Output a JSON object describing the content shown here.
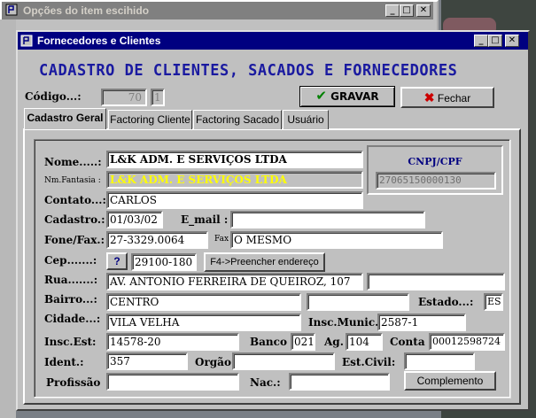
{
  "background_window": {
    "title": "Opções do item escihido"
  },
  "window": {
    "title": "Fornecedores e Clientes",
    "minimize": "_",
    "maximize": "□",
    "close": "✕"
  },
  "heading": "CADASTRO DE  CLIENTES, SACADOS E FORNECEDORES",
  "codigo": {
    "label": "Código...:",
    "value": "70",
    "suffix": "1"
  },
  "buttons": {
    "gravar": "GRAVAR",
    "fechar": "Fechar",
    "help": "?",
    "preencher": "F4->Preencher endereço",
    "complemento": "Complemento"
  },
  "tabs": [
    {
      "label": "Cadastro Geral"
    },
    {
      "label": "Factoring Cliente"
    },
    {
      "label": "Factoring  Sacado"
    },
    {
      "label": "Usuário"
    }
  ],
  "cnpj": {
    "label": "CNPJ/CPF",
    "value": "27065150000130"
  },
  "form": {
    "nome": {
      "label": "Nome.....:",
      "value": "L&K ADM. E SERVIÇOS LTDA"
    },
    "fantasia": {
      "label": "Nm.Fantasia :",
      "value": "L&K ADM. E SERVIÇOS LTDA"
    },
    "contato": {
      "label": "Contato...:",
      "value": "CARLOS"
    },
    "cadastro": {
      "label": "Cadastro.:",
      "value": "01/03/02"
    },
    "email": {
      "label": "E_mail :",
      "value": ""
    },
    "fone": {
      "label": "Fone/Fax.:",
      "value": "27-3329.0064"
    },
    "fax": {
      "label": "Fax",
      "value": "O MESMO"
    },
    "cep": {
      "label": "Cep.......:",
      "value": "29100-180"
    },
    "rua": {
      "label": "Rua.......:",
      "value": "AV. ANTONIO FERREIRA DE QUEIROZ, 107",
      "extra": ""
    },
    "bairro": {
      "label": "Bairro...:",
      "value": "CENTRO",
      "extra": ""
    },
    "estado": {
      "label": "Estado...:",
      "value": "ES"
    },
    "cidade": {
      "label": "Cidade...:",
      "value": "VILA VELHA"
    },
    "inscmunic": {
      "label": "Insc.Munic.",
      "value": "2587-1"
    },
    "inscest": {
      "label": "Insc.Est:",
      "value": "14578-20"
    },
    "banco": {
      "label": "Banco",
      "value": "021"
    },
    "ag": {
      "label": "Ag.",
      "value": "104"
    },
    "conta": {
      "label": "Conta",
      "value": "00012598724"
    },
    "ident": {
      "label": "Ident.:",
      "value": "357"
    },
    "orgao": {
      "label": "Orgão:",
      "value": ""
    },
    "estcivil": {
      "label": "Est.Civil:",
      "value": ""
    },
    "profissao": {
      "label": "Profissão",
      "value": ""
    },
    "nac": {
      "label": "Nac.:",
      "value": ""
    }
  },
  "colors": {
    "title_bar": "#000080",
    "heading": "#1a1aa0",
    "fantasia_text": "#ffff00",
    "cnpj_label": "#000080",
    "gravar_check": "#008000",
    "fechar_x": "#cc0000"
  }
}
